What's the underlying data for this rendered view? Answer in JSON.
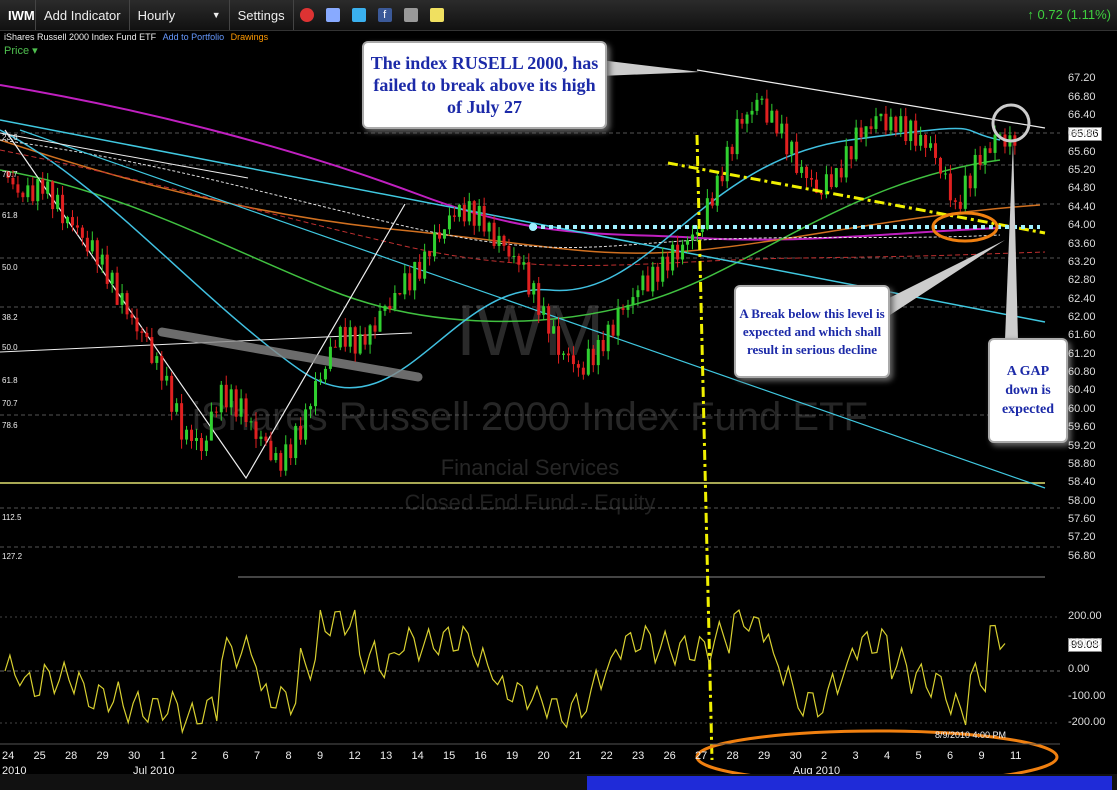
{
  "toolbar": {
    "symbol": "IWM",
    "add_indicator": "Add Indicator",
    "interval": "Hourly",
    "settings": "Settings",
    "change": "0.72 (1.11%)"
  },
  "subbar": {
    "instrument": "iShares Russell 2000 Index Fund ETF",
    "add_portfolio": "Add to Portfolio",
    "drawings": "Drawings"
  },
  "price_label": "Price",
  "watermark": {
    "symbol": "IWM",
    "name": "iShares Russell 2000 Index Fund ETF",
    "sector": "Financial Services",
    "type": "Closed End Fund - Equity"
  },
  "callouts": {
    "top": "The index RUSELL 2000, has failed to break above its high of July 27",
    "middle": "A Break below this level is expected and which shall result in serious decline",
    "right": "A GAP down is expected"
  },
  "current_price": "65.86",
  "osc_value": "99.08",
  "timestamp": "8/9/2010 4:00 PM",
  "colors": {
    "up": "#30d030",
    "down": "#e02020",
    "callout_text": "#1c2aa8",
    "annotation": "#f0f000",
    "highlight": "#f08010"
  },
  "chart_data": {
    "type": "candlestick",
    "ylim": [
      56.6,
      67.4
    ],
    "y_ticks": [
      "67.20",
      "66.80",
      "66.40",
      "66.00",
      "65.60",
      "65.20",
      "64.80",
      "64.40",
      "64.00",
      "63.60",
      "63.20",
      "62.80",
      "62.40",
      "62.00",
      "61.60",
      "61.20",
      "60.80",
      "60.40",
      "60.00",
      "59.60",
      "59.20",
      "58.80",
      "58.40",
      "58.00",
      "57.60",
      "57.20",
      "56.80"
    ],
    "x_ticks": [
      "24",
      "25",
      "28",
      "29",
      "30",
      "1",
      "2",
      "6",
      "7",
      "8",
      "9",
      "12",
      "13",
      "14",
      "15",
      "16",
      "19",
      "20",
      "21",
      "22",
      "23",
      "26",
      "27",
      "28",
      "29",
      "30",
      "2",
      "3",
      "4",
      "5",
      "6",
      "9",
      "11"
    ],
    "x_period_labels": [
      "2010",
      "Jul 2010",
      "Aug 2010"
    ],
    "fib_labels": [
      "23.6",
      "70.7",
      "61.8",
      "50.0",
      "38.2",
      "50.0",
      "61.8",
      "70.7",
      "78.6",
      "112.5",
      "127.2"
    ],
    "oscillator_ticks": [
      "200.00",
      "100.00",
      "0.00",
      "-100.00",
      "-200.00"
    ],
    "close_series": [
      65.2,
      64.6,
      64.9,
      64.3,
      63.8,
      63.2,
      62.3,
      61.6,
      60.8,
      59.6,
      59.2,
      60.4,
      60.0,
      59.3,
      58.8,
      59.6,
      60.8,
      61.7,
      61.4,
      62.0,
      62.6,
      63.1,
      63.9,
      64.4,
      64.2,
      63.6,
      63.2,
      62.3,
      61.4,
      60.9,
      61.3,
      62.0,
      62.6,
      63.0,
      63.5,
      63.9,
      64.9,
      66.1,
      66.7,
      66.2,
      65.4,
      64.8,
      65.1,
      65.9,
      66.3,
      66.2,
      66.0,
      65.6,
      64.4,
      65.3,
      65.86
    ]
  }
}
